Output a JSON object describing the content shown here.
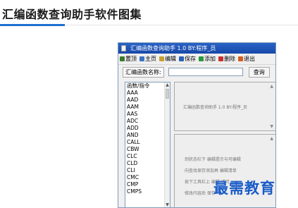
{
  "page": {
    "title": "汇编函数查询助手软件图集"
  },
  "window": {
    "title": "汇编函数查询助手 1.0 BY:程序_员"
  },
  "toolbar": [
    {
      "label": "置顶",
      "icon": "pin-icon",
      "color": "#3c7a2a"
    },
    {
      "label": "主页",
      "icon": "home-icon",
      "color": "#3a72c8"
    },
    {
      "label": "编辑",
      "icon": "edit-icon",
      "color": "#c8a030"
    },
    {
      "label": "保存",
      "icon": "save-icon",
      "color": "#2a60b8"
    },
    {
      "label": "添加",
      "icon": "add-icon",
      "color": "#2a9a3a"
    },
    {
      "label": "删除",
      "icon": "delete-icon",
      "color": "#c83030"
    },
    {
      "label": "退出",
      "icon": "exit-icon",
      "color": "#d06020"
    }
  ],
  "search": {
    "label": "汇编函数名称:",
    "value": "",
    "button": "查询"
  },
  "list": {
    "header": "函数/指令",
    "items": [
      "AAA",
      "AAD",
      "AAM",
      "AAS",
      "ADC",
      "ADD",
      "AND",
      "CALL",
      "CBW",
      "CLC",
      "CLD",
      "CLI",
      "CMC",
      "CMP",
      "CMPS"
    ]
  },
  "info_pane": {
    "text": "汇编函数查询助手 1.0 BY:程序_员"
  },
  "help_pane": {
    "lines": [
      "到状态栏下 编辑提示与可编辑",
      "向查找保存添加再 编辑清单",
      "按下工具栏上 编辑 或可",
      "修改内容后 保存"
    ]
  },
  "watermark": "最需教育"
}
